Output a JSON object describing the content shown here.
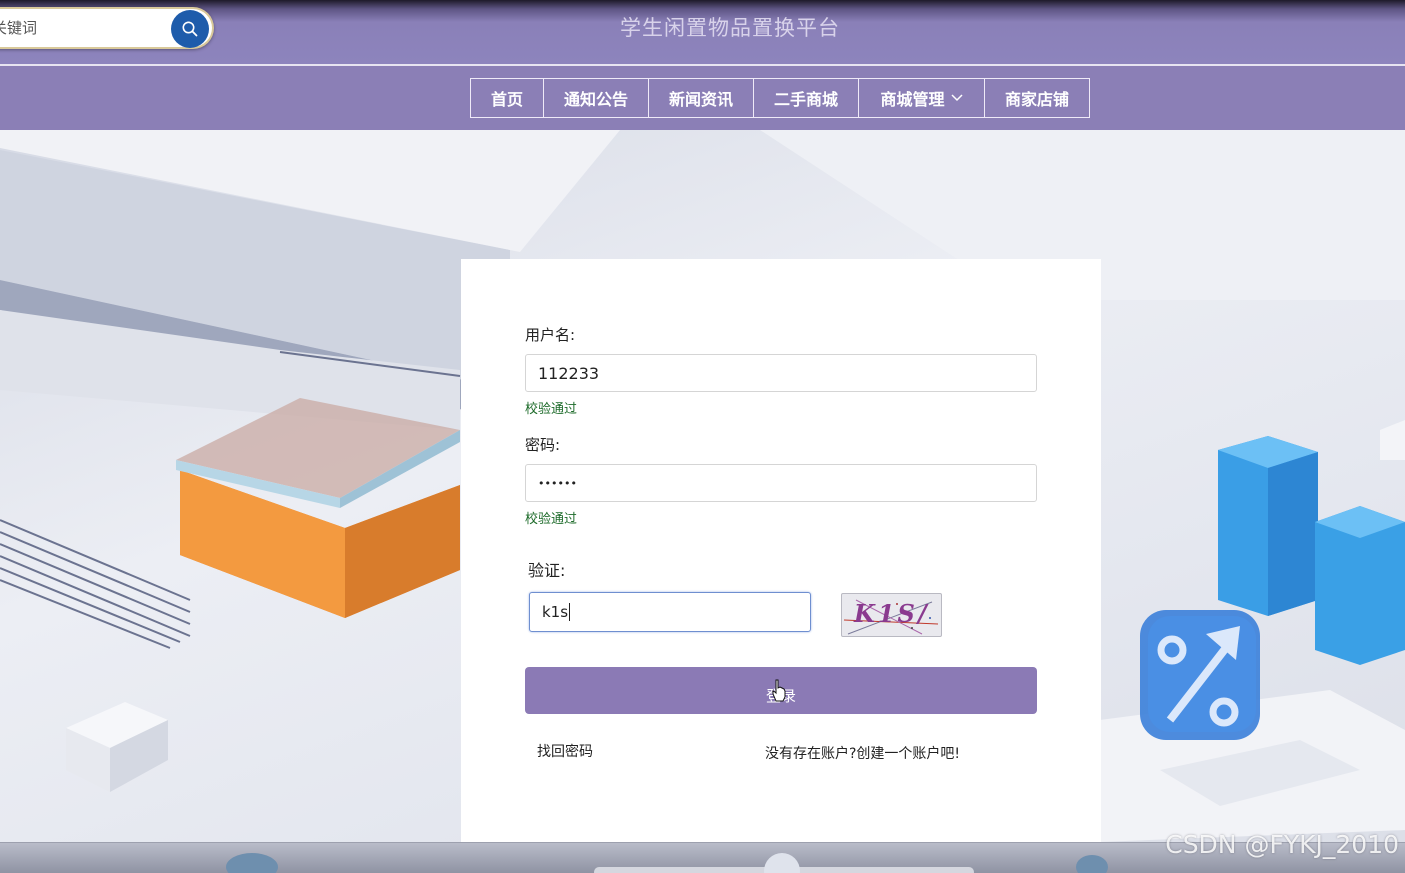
{
  "header": {
    "search_placeholder": "关键词",
    "search_icon": "search-icon",
    "site_title": "学生闲置物品置换平台"
  },
  "nav": {
    "items": [
      {
        "label": "首页"
      },
      {
        "label": "通知公告"
      },
      {
        "label": "新闻资讯"
      },
      {
        "label": "二手商城"
      },
      {
        "label": "商城管理",
        "icon": "chevron-down-icon"
      },
      {
        "label": "商家店铺"
      }
    ]
  },
  "login": {
    "username_label": "用户名:",
    "username_value": "112233",
    "username_status": "校验通过",
    "password_label": "密码:",
    "password_value": "••••••",
    "password_status": "校验通过",
    "captcha_label": "验证:",
    "captcha_value": "k1s",
    "captcha_image_text": "K1S/",
    "login_button": "登录",
    "forgot_password": "找回密码",
    "register_link": "没有存在账户?创建一个账户吧!"
  },
  "watermark": "CSDN @FYKJ_2010",
  "colors": {
    "header_bg": "#8d84bd",
    "nav_bg": "#8b7fb6",
    "button_bg": "#8b7ab5",
    "status_ok": "#1d6b2a",
    "search_btn": "#1e5cab"
  }
}
